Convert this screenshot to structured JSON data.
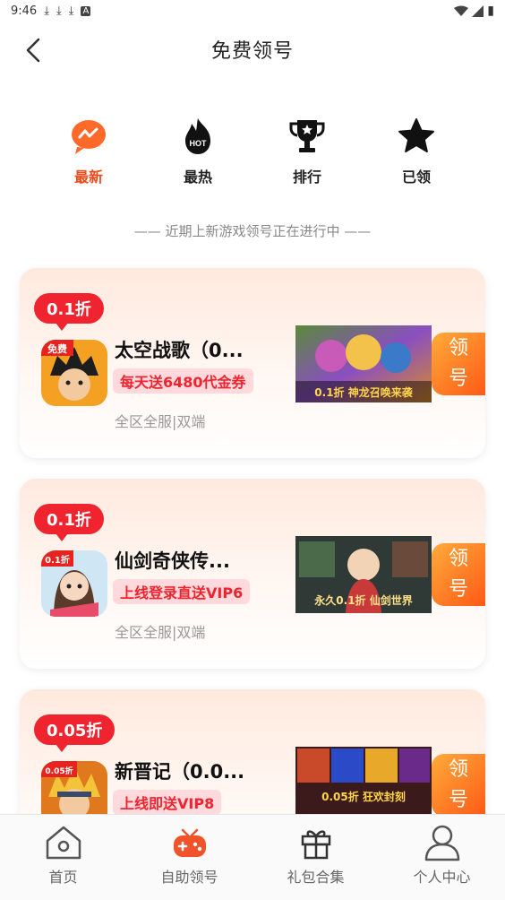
{
  "status_bar": {
    "time": "9:46",
    "download_glyph": "⤓",
    "app_glyph": "A",
    "battery_glyph": "▮"
  },
  "nav": {
    "title": "免费领号"
  },
  "tabs": [
    {
      "label": "最新",
      "icon": "new-icon",
      "active": true
    },
    {
      "label": "最热",
      "icon": "hot-icon",
      "active": false
    },
    {
      "label": "排行",
      "icon": "trophy-icon",
      "active": false
    },
    {
      "label": "已领",
      "icon": "star-icon",
      "active": false
    }
  ],
  "subtitle": "—— 近期上新游戏领号正在进行中 ——",
  "games": [
    {
      "discount": "0.1折",
      "name": "太空战歌（0...",
      "promo": "每天送6480代金券",
      "meta": "全区全服|双端",
      "icon_text": "免费",
      "banner_text": "0.1折 神龙召唤来袭",
      "claim_top": "领",
      "claim_bottom": "号"
    },
    {
      "discount": "0.1折",
      "name": "仙剑奇侠传...",
      "promo": "上线登录直送VIP6",
      "meta": "全区全服|双端",
      "icon_text": "0.1折",
      "banner_text": "永久0.1折 仙剑世界",
      "claim_top": "领",
      "claim_bottom": "号"
    },
    {
      "discount": "0.05折",
      "name": "新晋记（0.0...",
      "promo": "上线即送VIP8",
      "meta": "",
      "icon_text": "0.05折",
      "banner_text": "0.05折 狂欢封刻",
      "claim_top": "领",
      "claim_bottom": "号"
    }
  ],
  "bottom_nav": [
    {
      "label": "首页",
      "icon": "home-icon"
    },
    {
      "label": "自助领号",
      "icon": "gamepad-icon"
    },
    {
      "label": "礼包合集",
      "icon": "gift-icon"
    },
    {
      "label": "个人中心",
      "icon": "user-icon"
    }
  ],
  "colors": {
    "accent": "#f04a1a",
    "badge": "#f0242f",
    "claim_start": "#ffab3a",
    "claim_end": "#ff5a16"
  }
}
